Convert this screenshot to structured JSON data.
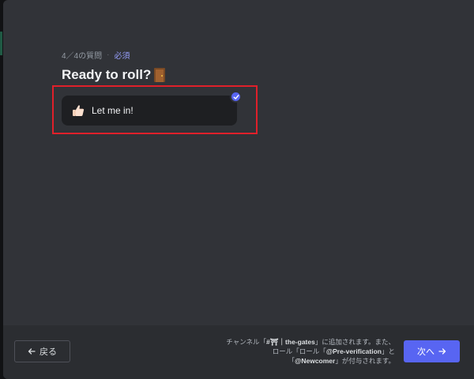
{
  "onboarding": {
    "progress_text": "4／4の質問",
    "separator": "·",
    "required_label": "必須",
    "question_title": "Ready to roll?",
    "title_emoji_icon": "door-icon",
    "options": [
      {
        "label": "Let me in!",
        "icon": "thumbs-up-icon",
        "selected": true
      }
    ]
  },
  "footer": {
    "back_label": "戻る",
    "next_label": "次へ",
    "note_parts": {
      "p1": "チャンネル「",
      "channel": "#⛩｜the-gates",
      "p2": "」に追加されます。また、",
      "p3": "ロール「ロール「",
      "role1": "@Pre-verification",
      "p4": "」と",
      "p5": "「",
      "role2": "@Newcomer",
      "p6": "」が付与されます。"
    }
  },
  "colors": {
    "accent": "#5865f2",
    "highlight": "#e0202a",
    "required": "#949cf7"
  }
}
